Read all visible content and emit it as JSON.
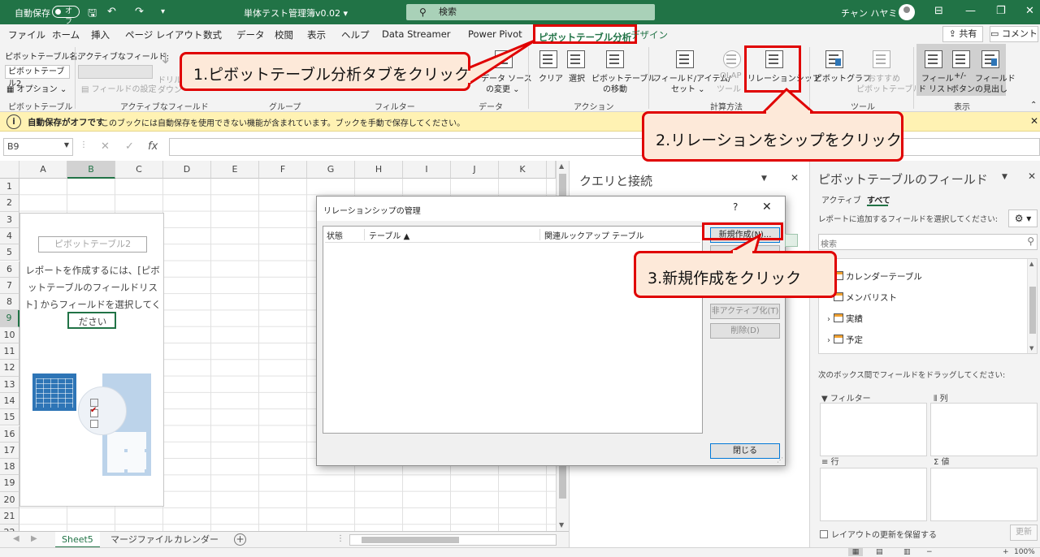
{
  "titlebar": {
    "autosave_label": "自動保存",
    "autosave_state": "オフ",
    "doc_title": "単体テスト管理簿v0.02 ▾",
    "search_placeholder": "検索",
    "user_name": "チャン ハヤミ"
  },
  "tabs": [
    {
      "label": "ファイル"
    },
    {
      "label": "ホーム"
    },
    {
      "label": "挿入"
    },
    {
      "label": "ページ レイアウト"
    },
    {
      "label": "数式"
    },
    {
      "label": "データ"
    },
    {
      "label": "校閲"
    },
    {
      "label": "表示"
    },
    {
      "label": "ヘルプ"
    },
    {
      "label": "Data Streamer"
    },
    {
      "label": "Power Pivot"
    },
    {
      "label": "ピボットテーブル分析"
    },
    {
      "label": "デザイン"
    }
  ],
  "tab_actions": {
    "share": "共有",
    "comment": "コメント"
  },
  "ribbon": {
    "pivot_name_label": "ピボットテーブル名:",
    "pivot_name_value": "ピボットテーブル2",
    "options_label": "オプション ⌄",
    "active_field_label": "アクティブなフィールド:",
    "field_settings_label": "フィールドの設定",
    "drill_down_label": "ドリル",
    "drill_down_label2": "ダウン",
    "data_source_label": "データ ソース",
    "data_source_label2": "の変更 ⌄",
    "clear_label": "クリア",
    "select_label": "選択",
    "move_pivot_label": "ピボットテーブル",
    "move_pivot_label2": "の移動",
    "fields_items_label": "フィールド/アイテム/",
    "fields_items_label2": "セット ⌄",
    "olap_label": "OLAP",
    "olap_label2": "ツール ⌄",
    "relationship_label": "リレーションシップ",
    "pivot_chart_label": "ピボットグラフ",
    "recommended_label": "おすすめ",
    "recommended_label2": "ピボットテーブル",
    "field_list_label": "フィール",
    "field_list_label2": "ド リスト",
    "plus_minus_label": "+/-",
    "plus_minus_label2": "ボタン",
    "field_headers_label": "フィールド",
    "field_headers_label2": "の見出し",
    "groups": [
      "ピボットテーブル",
      "アクティブなフィールド",
      "グループ",
      "フィルター",
      "データ",
      "アクション",
      "計算方法",
      "ツール",
      "表示"
    ]
  },
  "infobar": {
    "bold": "自動保存がオフです",
    "message": "このブックには自動保存を使用できない機能が含まれています。ブックを手動で保存してください。"
  },
  "formulabar": {
    "namebox": "B9",
    "fx": "fx"
  },
  "grid": {
    "columns": [
      "A",
      "B",
      "C",
      "D",
      "E",
      "F",
      "G",
      "H",
      "I",
      "J",
      "K"
    ],
    "rows": [
      "1",
      "2",
      "3",
      "4",
      "5",
      "6",
      "7",
      "8",
      "9",
      "10",
      "11",
      "12",
      "13",
      "14",
      "15",
      "16",
      "17",
      "18",
      "19",
      "20",
      "21",
      "22"
    ],
    "selected_column": "B",
    "selected_row": "9",
    "pivot_placeholder_name": "ピボットテーブル2",
    "pivot_instructions": "レポートを作成するには、[ピボットテーブルのフィールドリスト] からフィールドを選択してください"
  },
  "sheets": [
    "Sheet5",
    "マージファイル",
    "カレンダー"
  ],
  "queries_pane": {
    "title": "クエリと接続"
  },
  "field_pane": {
    "title": "ピボットテーブルのフィールド",
    "tab_active": "アクティブ",
    "tab_all": "すべて",
    "hint": "レポートに追加するフィールドを選択してください:",
    "search_placeholder": "検索",
    "fields": [
      {
        "name": "カレンダーテーブル",
        "expandable": false
      },
      {
        "name": "メンバリスト",
        "expandable": false
      },
      {
        "name": "実績",
        "expandable": true
      },
      {
        "name": "予定",
        "expandable": true
      }
    ],
    "drag_hint": "次のボックス間でフィールドをドラッグしてください:",
    "areas": {
      "filter": "フィルター",
      "columns": "列",
      "rows": "行",
      "values": "値"
    },
    "defer_label": "レイアウトの更新を保留する",
    "update_label": "更新"
  },
  "dialog": {
    "title": "リレーションシップの管理",
    "help": "?",
    "columns": [
      "状態",
      "テーブル ▲",
      "関連ルックアップ テーブル"
    ],
    "buttons": {
      "new": "新規作成(N)...",
      "deactivate": "非アクティブ化(T)",
      "delete": "削除(D)",
      "close": "閉じる"
    }
  },
  "callouts": {
    "step1": "1.ピボットテーブル分析タブをクリック",
    "step2": "2.リレーションをシップをクリック",
    "step3": "3.新規作成をクリック"
  },
  "status": {
    "zoom": "100%"
  },
  "colors": {
    "excel_green": "#217346",
    "callout_red": "#e00000",
    "callout_fill": "#fde9d9"
  }
}
